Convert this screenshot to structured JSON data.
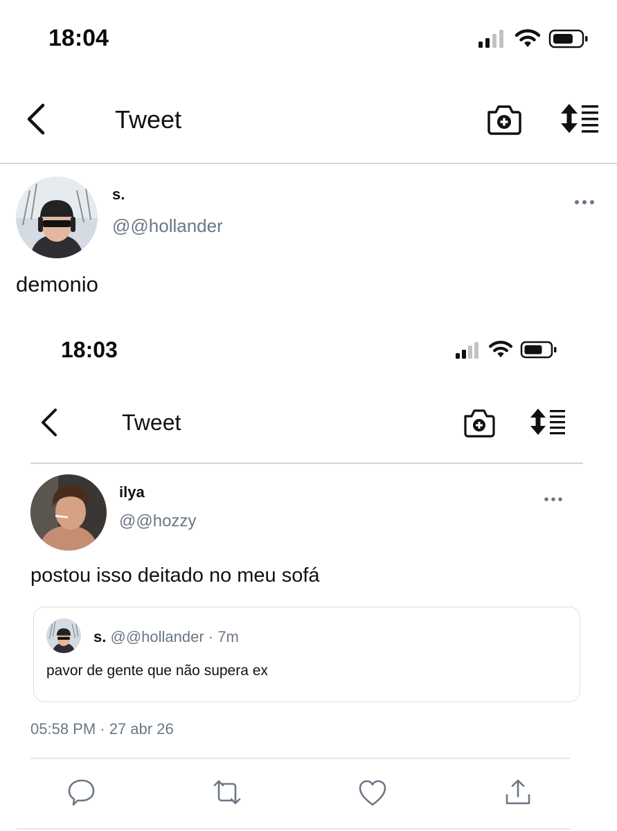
{
  "outer": {
    "status_time": "18:04",
    "nav_title": "Tweet",
    "tweet": {
      "display_name": "s.",
      "handle": "@@hollander",
      "text": "demonio"
    }
  },
  "inner": {
    "status_time": "18:03",
    "nav_title": "Tweet",
    "tweet": {
      "display_name": "ilya",
      "handle": "@@hozzy",
      "text": "postou isso deitado no meu sofá",
      "quoted": {
        "display_name": "s.",
        "handle_time": "@@hollander · 7m",
        "text": "pavor de gente que não supera ex"
      },
      "timestamp": "05:58 PM · 27 abr 26"
    }
  },
  "icons": {
    "back": "chevron-left-icon",
    "camera": "camera-plus-icon",
    "sort": "sort-list-icon",
    "more": "more-horizontal-icon",
    "reply": "reply-icon",
    "retweet": "retweet-icon",
    "like": "heart-icon",
    "share": "share-icon"
  },
  "colors": {
    "handle_gray": "#6b7784",
    "divider": "#cfd4d8",
    "text": "#111111"
  }
}
